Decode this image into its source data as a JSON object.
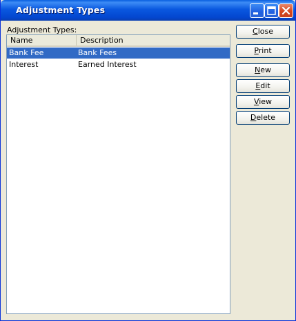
{
  "window": {
    "title": "Adjustment Types"
  },
  "list": {
    "label": "Adjustment Types:",
    "columns": [
      "Name",
      "Description"
    ],
    "rows": [
      {
        "name": "Bank Fee",
        "description": "Bank Fees",
        "selected": true
      },
      {
        "name": "Interest",
        "description": "Earned Interest",
        "selected": false
      }
    ]
  },
  "buttons": {
    "close": {
      "first": "C",
      "rest": "lose"
    },
    "print": {
      "first": "P",
      "rest": "rint"
    },
    "new": {
      "first": "N",
      "rest": "ew"
    },
    "edit": {
      "first": "E",
      "rest": "dit"
    },
    "view": {
      "first": "V",
      "rest": "iew"
    },
    "delete": {
      "first": "D",
      "rest": "elete"
    }
  },
  "colors": {
    "selection": "#316ac5",
    "titlebar": "#0a58e0",
    "face": "#ece9d8"
  }
}
